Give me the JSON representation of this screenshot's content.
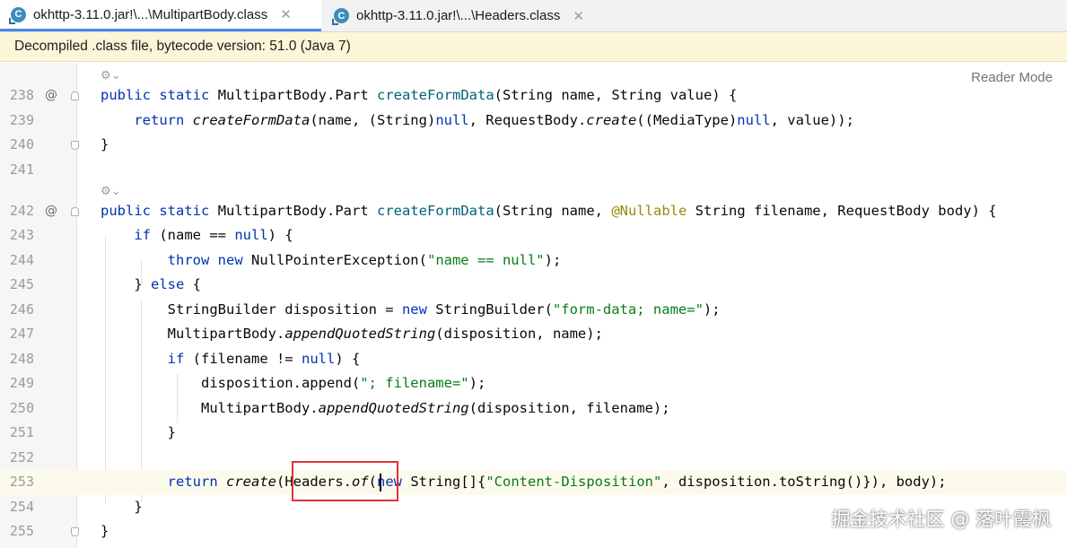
{
  "tabs": [
    {
      "label": "okhttp-3.11.0.jar!\\...\\MultipartBody.class",
      "icon": "class-file-icon",
      "close": "✕"
    },
    {
      "label": "okhttp-3.11.0.jar!\\...\\Headers.class",
      "icon": "class-file-icon",
      "close": "✕"
    }
  ],
  "banner": {
    "text": "Decompiled .class file, bytecode version: 51.0 (Java 7)"
  },
  "reader_mode": "Reader Mode",
  "hint_icon": "⚙⌄",
  "lines": [
    {
      "num": "238",
      "marker": "@"
    },
    {
      "num": "239",
      "marker": ""
    },
    {
      "num": "240",
      "marker": ""
    },
    {
      "num": "241",
      "marker": ""
    },
    {
      "num": "242",
      "marker": "@"
    },
    {
      "num": "243",
      "marker": ""
    },
    {
      "num": "244",
      "marker": ""
    },
    {
      "num": "245",
      "marker": ""
    },
    {
      "num": "246",
      "marker": ""
    },
    {
      "num": "247",
      "marker": ""
    },
    {
      "num": "248",
      "marker": ""
    },
    {
      "num": "249",
      "marker": ""
    },
    {
      "num": "250",
      "marker": ""
    },
    {
      "num": "251",
      "marker": ""
    },
    {
      "num": "252",
      "marker": ""
    },
    {
      "num": "253",
      "marker": ""
    },
    {
      "num": "254",
      "marker": ""
    },
    {
      "num": "255",
      "marker": ""
    }
  ],
  "code": {
    "public": "public",
    "static": "static",
    "return": "return",
    "if": "if",
    "else": "else",
    "throw": "throw",
    "new": "new",
    "null": "null",
    "type_part": "MultipartBody.Part",
    "fn_create_form_data": "createFormData",
    "sig1_params_a": "(String name, String value) {",
    "l239_a": "(name, (String)",
    "l239_b": ", RequestBody.",
    "create": "create",
    "l239_c": "((MediaType)",
    "l239_d": ", value));",
    "close_brace": "}",
    "sig2_params_a": "(String name, ",
    "nullable": "@Nullable",
    "sig2_params_b": " String filename, RequestBody body) {",
    "l243_a": " (name == ",
    "l243_b": ") {",
    "l244_a": " NullPointerException(",
    "l244_str": "\"name == null\"",
    "l244_b": ");",
    "l245_a": "} ",
    "l245_b": " {",
    "l246_a": "StringBuilder disposition = ",
    "l246_b": " StringBuilder(",
    "l246_str": "\"form-data; name=\"",
    "l246_c": ");",
    "mpb": "MultipartBody.",
    "append_quoted": "appendQuotedString",
    "l247_b": "(disposition, name);",
    "l248_a": " (filename != ",
    "l248_b": ") {",
    "l249_a": "disposition.append(",
    "l249_str": "\"; filename=\"",
    "l249_b": ");",
    "l250_b": "(disposition, filename);",
    "l253_a": "(Headers.",
    "of": "of",
    "l253_b": "(",
    "l253_c": " String[]{",
    "l253_str": "\"Content-Disposition\"",
    "l253_d": ", disposition.toString()}), body);"
  },
  "watermark": "掘金技术社区 @ 落叶霞枫"
}
